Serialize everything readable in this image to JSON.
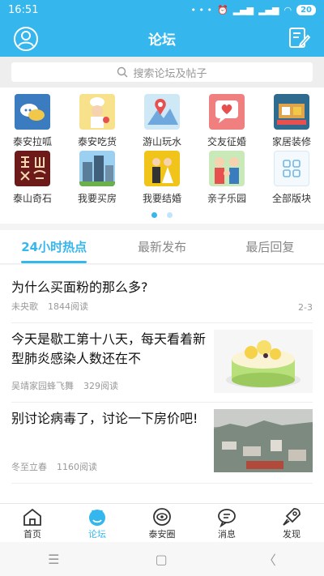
{
  "status": {
    "time": "16:51",
    "battery": "20"
  },
  "header": {
    "title": "论坛"
  },
  "search": {
    "placeholder": "搜索论坛及帖子"
  },
  "categories": [
    {
      "label": "泰安拉呱",
      "icon": "chat-bubbles-icon",
      "color": "#3b7bbf"
    },
    {
      "label": "泰安吃货",
      "icon": "chef-icon",
      "color": "#f2c84b"
    },
    {
      "label": "游山玩水",
      "icon": "map-pin-icon",
      "color": "#5aa6d6"
    },
    {
      "label": "交友征婚",
      "icon": "heart-message-icon",
      "color": "#e8504f"
    },
    {
      "label": "家居装修",
      "icon": "home-decor-icon",
      "color": "#2f6b8e"
    },
    {
      "label": "泰山奇石",
      "icon": "stone-calligraphy-icon",
      "color": "#6d1a1a"
    },
    {
      "label": "我要买房",
      "icon": "buildings-icon",
      "color": "#79b7e0"
    },
    {
      "label": "我要结婚",
      "icon": "wedding-couple-icon",
      "color": "#f0c419"
    },
    {
      "label": "亲子乐园",
      "icon": "family-icon",
      "color": "#9fd38a"
    },
    {
      "label": "全部版块",
      "icon": "grid-icon",
      "color": "#eef5fb"
    }
  ],
  "tabs": [
    "24小时热点",
    "最新发布",
    "最后回复"
  ],
  "posts": [
    {
      "title": "为什么买面粉的那么多?",
      "author": "未央歌",
      "reads": "1844阅读",
      "pages": "2-3"
    },
    {
      "title": "今天是歇工第十八天，每天看着新型肺炎感染人数还在不",
      "author": "吴靖家园蜂飞舞",
      "reads": "329阅读"
    },
    {
      "title": "别讨论病毒了，讨论一下房价吧!",
      "author": "冬至立春",
      "reads": "1160阅读"
    }
  ],
  "tabbar": [
    {
      "label": "首页",
      "icon": "home-icon"
    },
    {
      "label": "论坛",
      "icon": "forum-icon"
    },
    {
      "label": "泰安圈",
      "icon": "circle-eye-icon"
    },
    {
      "label": "消息",
      "icon": "message-icon"
    },
    {
      "label": "发现",
      "icon": "rocket-icon"
    }
  ],
  "colors": {
    "accent": "#35b7ee"
  }
}
